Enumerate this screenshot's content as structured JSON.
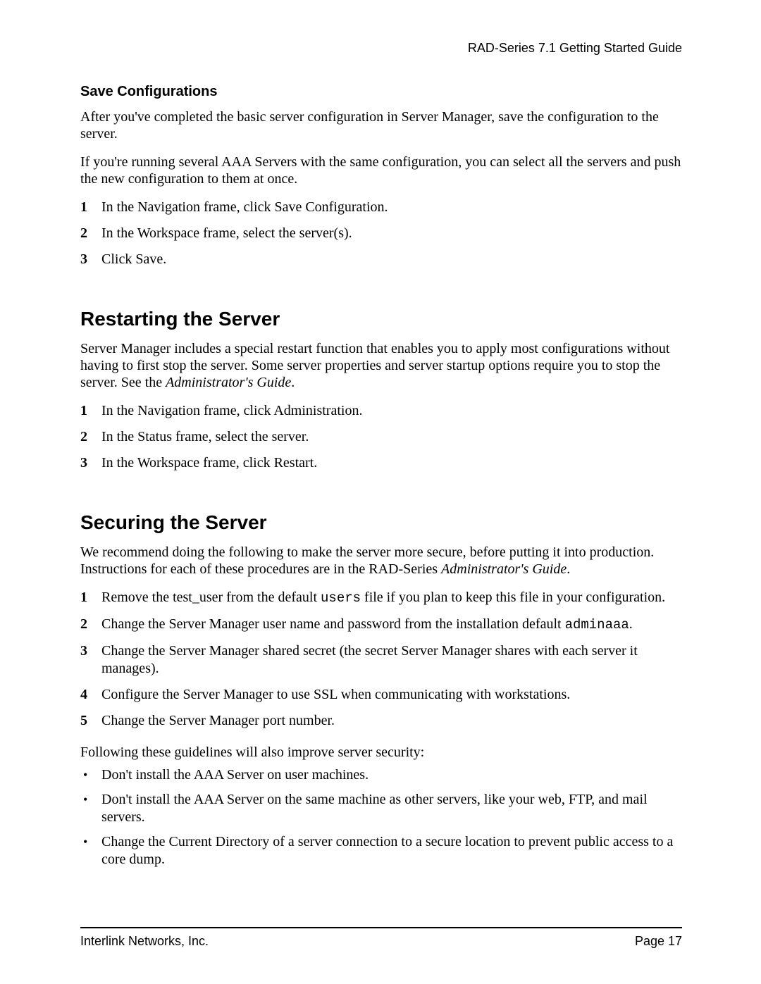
{
  "header": {
    "title": "RAD-Series 7.1 Getting Started Guide"
  },
  "sections": {
    "saveConfig": {
      "heading": "Save Configurations",
      "p1": "After you've completed the basic server configuration in Server Manager, save the configuration to the server.",
      "p2": "If you're running several AAA Servers with the same configuration, you can select all the servers and push the new configuration to them at once.",
      "steps": [
        "In the Navigation frame, click Save Configuration.",
        "In the Workspace frame, select the server(s).",
        "Click Save."
      ]
    },
    "restarting": {
      "heading": "Restarting the Server",
      "p1a": "Server Manager includes a special restart function that enables you to apply most configurations without having to first stop the server. Some server properties and server startup options require you to stop the server. See the ",
      "p1b": "Administrator's Guide",
      "p1c": ".",
      "steps": [
        "In the Navigation frame, click Administration.",
        "In the Status frame, select the server.",
        "In the Workspace frame, click Restart."
      ]
    },
    "securing": {
      "heading": "Securing the Server",
      "p1a": "We recommend doing the following to make the server more secure, before putting it into production. Instructions for each of these procedures are in the RAD-Series ",
      "p1b": "Administrator's Guide",
      "p1c": ".",
      "steps": {
        "s1a": "Remove the test_user from the default ",
        "s1b": "users",
        "s1c": " file if you plan to keep this file in your configuration.",
        "s2a": "Change the Server Manager user name and password from the installation default ",
        "s2b": "adminaaa",
        "s2c": ".",
        "s3": "Change the Server Manager shared secret (the secret Server Manager shares with each server it manages).",
        "s4": "Configure the Server Manager to use SSL when communicating with workstations.",
        "s5": "Change the Server Manager port number."
      },
      "p2": "Following these guidelines will also improve server security:",
      "bullets": [
        "Don't install the AAA Server on user machines.",
        "Don't install the AAA Server on the same machine as other servers, like your web, FTP, and mail servers.",
        "Change the Current Directory of a server connection to a secure location to prevent public access to a core dump."
      ]
    }
  },
  "nums": {
    "n1": "1",
    "n2": "2",
    "n3": "3",
    "n4": "4",
    "n5": "5"
  },
  "footer": {
    "left": "Interlink Networks, Inc.",
    "right": "Page 17"
  }
}
